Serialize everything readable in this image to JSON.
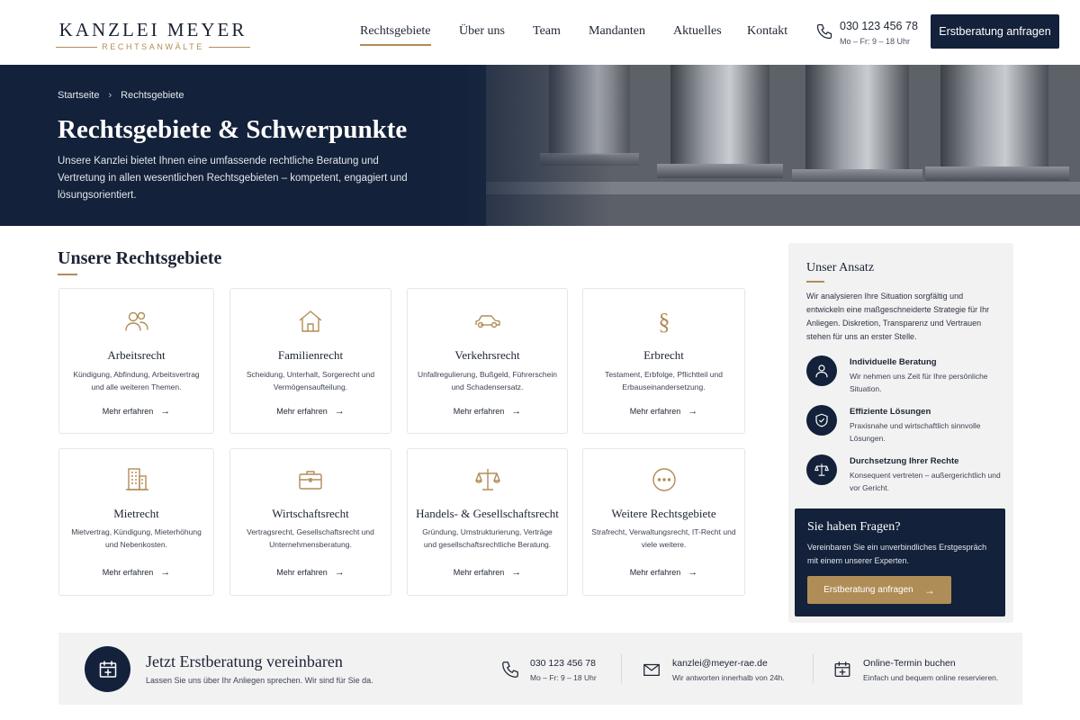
{
  "header": {
    "logo_main": "KANZLEI MEYER",
    "logo_sub": "RECHTSANWÄLTE",
    "nav": [
      {
        "label": "Rechtsgebiete",
        "active": true
      },
      {
        "label": "Über uns"
      },
      {
        "label": "Team"
      },
      {
        "label": "Mandanten"
      },
      {
        "label": "Aktuelles"
      },
      {
        "label": "Kontakt"
      }
    ],
    "phone": "030 123 456 78",
    "hours": "Mo – Fr: 9 – 18 Uhr",
    "cta_label": "Erstberatung anfragen"
  },
  "hero": {
    "breadcrumb_home": "Startseite",
    "breadcrumb_sep": "›",
    "breadcrumb_current": "Rechtsgebiete",
    "title": "Rechtsgebiete & Schwerpunkte",
    "text": "Unsere Kanzlei bietet Ihnen eine umfassende rechtliche Beratung und Vertretung in allen wesentlichen Rechtsgebieten – kompetent, engagiert und lösungsorientiert."
  },
  "main": {
    "title": "Unsere Rechtsgebiete",
    "cards": [
      {
        "icon": "people-icon",
        "title": "Arbeitsrecht",
        "desc": "Kündigung, Abfindung, Arbeitsvertrag und alle weiteren Themen.",
        "link": "Mehr erfahren"
      },
      {
        "icon": "house-icon",
        "title": "Familienrecht",
        "desc": "Scheidung, Unterhalt, Sorgerecht und Vermögensaufteilung.",
        "link": "Mehr erfahren"
      },
      {
        "icon": "car-icon",
        "title": "Verkehrsrecht",
        "desc": "Unfallregulierung, Bußgeld, Führerschein und Schadensersatz.",
        "link": "Mehr erfahren"
      },
      {
        "icon": "paragraph-icon",
        "title": "Erbrecht",
        "desc": "Testament, Erbfolge, Pflichtteil und Erbauseinandersetzung.",
        "link": "Mehr erfahren"
      },
      {
        "icon": "building-icon",
        "title": "Mietrecht",
        "desc": "Mietvertrag, Kündigung, Mieterhöhung und Nebenkosten.",
        "link": "Mehr erfahren"
      },
      {
        "icon": "briefcase-icon",
        "title": "Wirtschaftsrecht",
        "desc": "Vertragsrecht, Gesellschaftsrecht und Unternehmensberatung.",
        "link": "Mehr erfahren"
      },
      {
        "icon": "scales-icon",
        "title": "Handels- & Gesellschaftsrecht",
        "desc": "Gründung, Umstrukturierung, Verträge und gesellschaftsrechtliche Beratung.",
        "link": "Mehr erfahren"
      },
      {
        "icon": "more-icon",
        "title": "Weitere Rechtsgebiete",
        "desc": "Strafrecht, Verwaltungsrecht, IT-Recht und viele weitere.",
        "link": "Mehr erfahren"
      }
    ]
  },
  "sidebar": {
    "title": "Unser Ansatz",
    "text": "Wir analysieren Ihre Situation sorgfältig und entwickeln eine maßgeschneiderte Strategie für Ihr Anliegen. Diskretion, Transparenz und Vertrauen stehen für uns an erster Stelle.",
    "features": [
      {
        "icon": "person-icon",
        "title": "Individuelle Beratung",
        "desc": "Wir nehmen uns Zeit für Ihre persönliche Situation."
      },
      {
        "icon": "shield-check-icon",
        "title": "Effiziente Lösungen",
        "desc": "Praxisnahe und wirtschaftlich sinnvolle Lösungen."
      },
      {
        "icon": "scales-icon",
        "title": "Durchsetzung Ihrer Rechte",
        "desc": "Konsequent vertreten – außergerichtlich und vor Gericht."
      }
    ],
    "cta": {
      "title": "Sie haben Fragen?",
      "text": "Vereinbaren Sie ein unverbindliches Erstgespräch mit einem unserer Experten.",
      "button": "Erstberatung anfragen"
    }
  },
  "bottom": {
    "title": "Jetzt Erstberatung vereinbaren",
    "sub": "Lassen Sie uns über Ihr Anliegen sprechen. Wir sind für Sie da.",
    "contacts": [
      {
        "icon": "phone-icon",
        "main": "030 123 456 78",
        "sub": "Mo – Fr: 9 – 18 Uhr"
      },
      {
        "icon": "mail-icon",
        "main": "kanzlei@meyer-rae.de",
        "sub": "Wir antworten innerhalb von 24h."
      },
      {
        "icon": "calendar-icon",
        "main": "Online-Termin buchen",
        "sub": "Einfach und bequem online reservieren."
      }
    ]
  },
  "colors": {
    "navy": "#13213a",
    "gold": "#b08d57",
    "panel": "#f2f2f3"
  }
}
